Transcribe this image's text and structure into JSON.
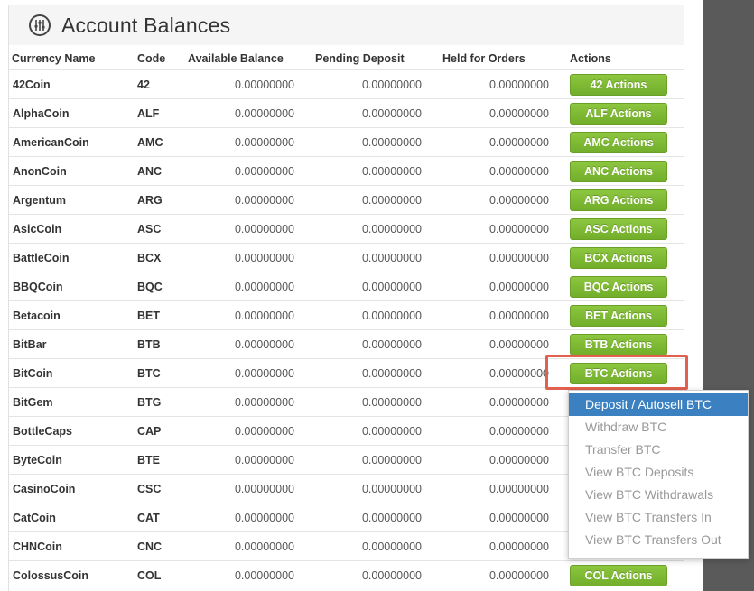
{
  "header": {
    "title": "Account Balances",
    "icon": "sliders-icon"
  },
  "columns": [
    "Currency Name",
    "Code",
    "Available Balance",
    "Pending Deposit",
    "Held for Orders",
    "Actions"
  ],
  "rows": [
    {
      "name": "42Coin",
      "code": "42",
      "available": "0.00000000",
      "pending": "0.00000000",
      "held": "0.00000000",
      "action": "42 Actions"
    },
    {
      "name": "AlphaCoin",
      "code": "ALF",
      "available": "0.00000000",
      "pending": "0.00000000",
      "held": "0.00000000",
      "action": "ALF Actions"
    },
    {
      "name": "AmericanCoin",
      "code": "AMC",
      "available": "0.00000000",
      "pending": "0.00000000",
      "held": "0.00000000",
      "action": "AMC Actions"
    },
    {
      "name": "AnonCoin",
      "code": "ANC",
      "available": "0.00000000",
      "pending": "0.00000000",
      "held": "0.00000000",
      "action": "ANC Actions"
    },
    {
      "name": "Argentum",
      "code": "ARG",
      "available": "0.00000000",
      "pending": "0.00000000",
      "held": "0.00000000",
      "action": "ARG Actions"
    },
    {
      "name": "AsicCoin",
      "code": "ASC",
      "available": "0.00000000",
      "pending": "0.00000000",
      "held": "0.00000000",
      "action": "ASC Actions"
    },
    {
      "name": "BattleCoin",
      "code": "BCX",
      "available": "0.00000000",
      "pending": "0.00000000",
      "held": "0.00000000",
      "action": "BCX Actions"
    },
    {
      "name": "BBQCoin",
      "code": "BQC",
      "available": "0.00000000",
      "pending": "0.00000000",
      "held": "0.00000000",
      "action": "BQC Actions"
    },
    {
      "name": "Betacoin",
      "code": "BET",
      "available": "0.00000000",
      "pending": "0.00000000",
      "held": "0.00000000",
      "action": "BET Actions"
    },
    {
      "name": "BitBar",
      "code": "BTB",
      "available": "0.00000000",
      "pending": "0.00000000",
      "held": "0.00000000",
      "action": "BTB Actions"
    },
    {
      "name": "BitCoin",
      "code": "BTC",
      "available": "0.00000000",
      "pending": "0.00000000",
      "held": "0.00000000",
      "action": "BTC Actions"
    },
    {
      "name": "BitGem",
      "code": "BTG",
      "available": "0.00000000",
      "pending": "0.00000000",
      "held": "0.00000000",
      "action": ""
    },
    {
      "name": "BottleCaps",
      "code": "CAP",
      "available": "0.00000000",
      "pending": "0.00000000",
      "held": "0.00000000",
      "action": ""
    },
    {
      "name": "ByteCoin",
      "code": "BTE",
      "available": "0.00000000",
      "pending": "0.00000000",
      "held": "0.00000000",
      "action": ""
    },
    {
      "name": "CasinoCoin",
      "code": "CSC",
      "available": "0.00000000",
      "pending": "0.00000000",
      "held": "0.00000000",
      "action": ""
    },
    {
      "name": "CatCoin",
      "code": "CAT",
      "available": "0.00000000",
      "pending": "0.00000000",
      "held": "0.00000000",
      "action": ""
    },
    {
      "name": "CHNCoin",
      "code": "CNC",
      "available": "0.00000000",
      "pending": "0.00000000",
      "held": "0.00000000",
      "action": ""
    },
    {
      "name": "ColossusCoin",
      "code": "COL",
      "available": "0.00000000",
      "pending": "0.00000000",
      "held": "0.00000000",
      "action": "COL Actions"
    }
  ],
  "dropdown": {
    "items": [
      "Deposit / Autosell BTC",
      "Withdraw BTC",
      "Transfer BTC",
      "View BTC Deposits",
      "View BTC Withdrawals",
      "View BTC Transfers In",
      "View BTC Transfers Out"
    ],
    "active_index": 0
  },
  "colors": {
    "button": "#7dba35",
    "highlight": "#e2604e",
    "menu_active": "#3b81c1",
    "sidebar": "#5a5a5a"
  }
}
